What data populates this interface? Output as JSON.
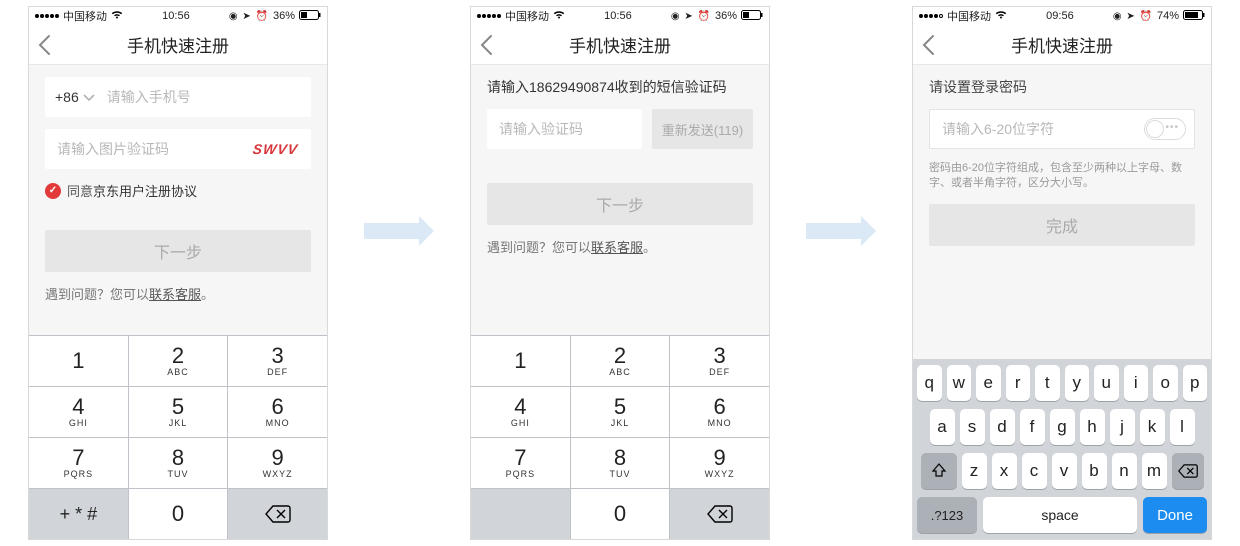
{
  "statusbar": {
    "carrier": "中国移动",
    "time_a": "10:56",
    "time_c": "09:56",
    "battery_a": "36%",
    "battery_c": "74%",
    "signal_full_a": 5,
    "signal_full_c": 4
  },
  "nav": {
    "title": "手机快速注册"
  },
  "step1": {
    "country_code": "+86",
    "phone_placeholder": "请输入手机号",
    "captcha_placeholder": "请输入图片验证码",
    "captcha_text": "SWVV",
    "agree_prefix": "同意",
    "agree_link": "京东用户注册协议",
    "next_btn": "下一步",
    "help_prefix": "遇到问题？您可以",
    "help_link": "联系客服",
    "help_suffix": "。"
  },
  "step2": {
    "sms_hint": "请输入18629490874收到的短信验证码",
    "code_placeholder": "请输入验证码",
    "resend_label": "重新发送(119)",
    "next_btn": "下一步",
    "help_prefix": "遇到问题？您可以",
    "help_link": "联系客服",
    "help_suffix": "。"
  },
  "step3": {
    "pw_label": "请设置登录密码",
    "pw_placeholder": "请输入6-20位字符",
    "pw_note": "密码由6-20位字符组成，包含至少两种以上字母、数字、或者半角字符，区分大小写。",
    "done_btn": "完成"
  },
  "keypad": {
    "keys": [
      [
        {
          "d": "1",
          "s": ""
        },
        {
          "d": "2",
          "s": "ABC"
        },
        {
          "d": "3",
          "s": "DEF"
        }
      ],
      [
        {
          "d": "4",
          "s": "GHI"
        },
        {
          "d": "5",
          "s": "JKL"
        },
        {
          "d": "6",
          "s": "MNO"
        }
      ],
      [
        {
          "d": "7",
          "s": "PQRS"
        },
        {
          "d": "8",
          "s": "TUV"
        },
        {
          "d": "9",
          "s": "WXYZ"
        }
      ]
    ],
    "symbols": "+ * #",
    "zero": "0"
  },
  "qwerty": {
    "row1": [
      "q",
      "w",
      "e",
      "r",
      "t",
      "y",
      "u",
      "i",
      "o",
      "p"
    ],
    "row2": [
      "a",
      "s",
      "d",
      "f",
      "g",
      "h",
      "j",
      "k",
      "l"
    ],
    "row3": [
      "z",
      "x",
      "c",
      "v",
      "b",
      "n",
      "m"
    ],
    "mode": ".?123",
    "space": "space",
    "done": "Done"
  }
}
